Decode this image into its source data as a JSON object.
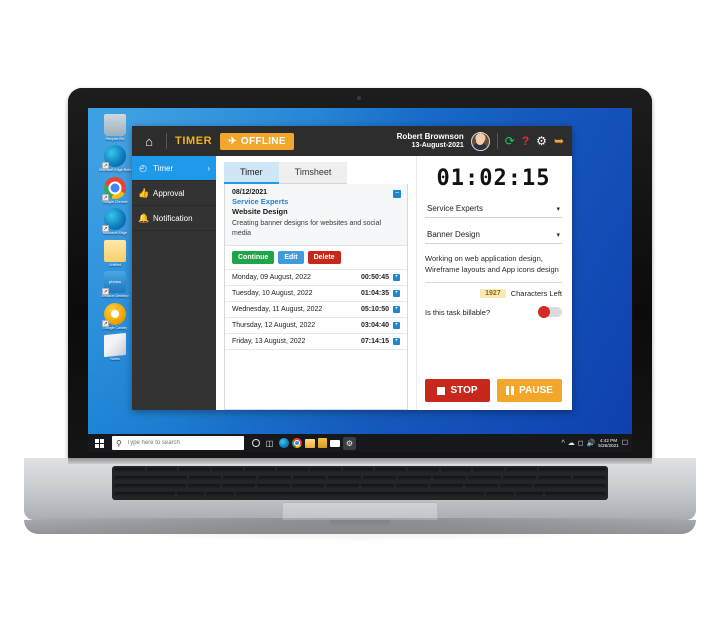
{
  "desktop": {
    "icons": [
      {
        "name": "Recycle Bin",
        "glyph_class": "ic-recycle",
        "glyph": "",
        "shortcut": false
      },
      {
        "name": "Microsoft Edge Beta",
        "glyph_class": "ic-edge",
        "glyph": "",
        "shortcut": true
      },
      {
        "name": "Google Chrome",
        "glyph_class": "ic-chrome",
        "glyph": "",
        "shortcut": true
      },
      {
        "name": "Microsoft Edge",
        "glyph_class": "ic-edge",
        "glyph": "",
        "shortcut": true
      },
      {
        "name": "Untitled",
        "glyph_class": "ic-folder",
        "glyph": "",
        "shortcut": false
      },
      {
        "name": "Amazon Desktop",
        "glyph_class": "ic-photos",
        "glyph": "photos",
        "shortcut": true
      },
      {
        "name": "Google Canary",
        "glyph_class": "ic-canary",
        "glyph": "",
        "shortcut": true
      },
      {
        "name": "Notes",
        "glyph_class": "ic-note",
        "glyph": "",
        "shortcut": false
      }
    ]
  },
  "taskbar": {
    "search_placeholder": "Type here to search",
    "search_value": "",
    "clock_time": "4:42 PM",
    "clock_date": "5/26/2021"
  },
  "app": {
    "header": {
      "home_icon": "⌂",
      "brand": "TIMER",
      "status_label": "OFFLINE",
      "status_icon": "✈",
      "user_name": "Robert Brownson",
      "user_date": "13-August-2021",
      "refresh_icon": "⟳",
      "help_icon": "?",
      "gear_icon": "⚙",
      "logout_icon": "→]"
    },
    "sidebar": {
      "items": [
        {
          "label": "Timer",
          "icon": "◴",
          "chevron": "›",
          "active": true
        },
        {
          "label": "Approval",
          "icon": "☝",
          "chevron": "",
          "active": false
        },
        {
          "label": "Notification",
          "icon": "🔔",
          "chevron": "",
          "active": false
        }
      ]
    },
    "tabs": [
      {
        "label": "Timer",
        "active": true
      },
      {
        "label": "Timsheet",
        "active": false
      }
    ],
    "entry": {
      "date": "08/12/2021",
      "client": "Service Experts",
      "project": "Website Design",
      "description": "Creating banner designs for websites and social media",
      "collapse_icon": "−",
      "actions": [
        {
          "label": "Continue",
          "style": "btn-continue"
        },
        {
          "label": "Edit",
          "style": "btn-edit"
        },
        {
          "label": "Delete",
          "style": "btn-delete"
        }
      ]
    },
    "days": [
      {
        "label": "Monday, 09 August, 2022",
        "duration": "00:50:45",
        "add_icon": "+"
      },
      {
        "label": "Tuesday, 10 August, 2022",
        "duration": "01:04:35",
        "add_icon": "+"
      },
      {
        "label": "Wednesday, 11 August, 2022",
        "duration": "05:10:50",
        "add_icon": "+"
      },
      {
        "label": "Thursday, 12 August, 2022",
        "duration": "03:04:40",
        "add_icon": "+"
      },
      {
        "label": "Friday, 13 August, 2022",
        "duration": "07:14:15",
        "add_icon": "+"
      }
    ],
    "right": {
      "elapsed": "01:02:15",
      "client_select": "Service Experts",
      "task_select": "Banner Design",
      "caret": "▾",
      "notes": "Working on web application design, Wireframe layouts and App icons design",
      "chars_left_count": "1927",
      "chars_left_label": "Characters Left",
      "billable_label": "Is this task billable?",
      "billable_on": false,
      "stop_label": "STOP",
      "pause_label": "PAUSE"
    }
  },
  "colors": {
    "brand_orange": "#f2a72c",
    "accent_blue": "#1e9ae8",
    "stop_red": "#c8271c",
    "continue_green": "#21a34a",
    "header_dark": "#2d2d2d"
  }
}
